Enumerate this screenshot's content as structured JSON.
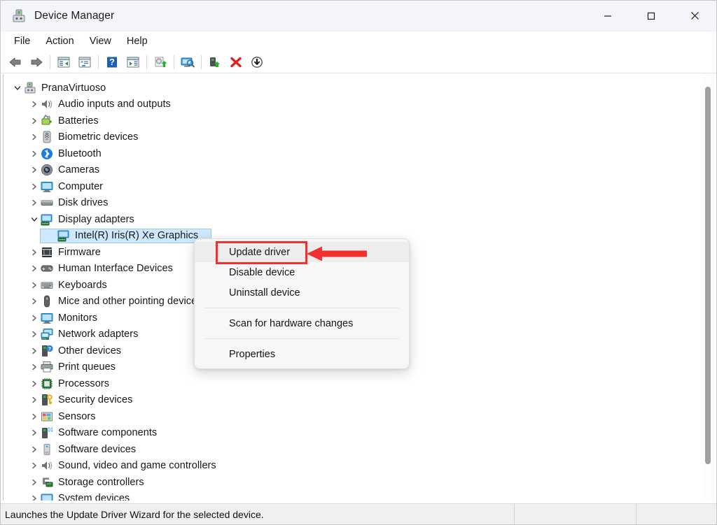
{
  "window": {
    "title": "Device Manager",
    "icon": "device-manager-icon",
    "controls": {
      "minimize": "—",
      "maximize": "□",
      "close": "✕"
    }
  },
  "menubar": {
    "items": [
      {
        "label": "File"
      },
      {
        "label": "Action"
      },
      {
        "label": "View"
      },
      {
        "label": "Help"
      }
    ]
  },
  "toolbar": {
    "buttons": [
      {
        "name": "back-icon"
      },
      {
        "name": "forward-icon"
      },
      {
        "name": "show-hide-console-tree-icon"
      },
      {
        "name": "properties-icon"
      },
      {
        "name": "help-icon"
      },
      {
        "name": "view-icon"
      },
      {
        "name": "update-driver-icon"
      },
      {
        "name": "scan-hardware-changes-icon"
      },
      {
        "name": "enable-device-icon"
      },
      {
        "name": "uninstall-device-icon"
      },
      {
        "name": "disable-device-icon"
      }
    ]
  },
  "tree": {
    "root": {
      "label": "PranaVirtuoso",
      "icon": "computer-node-icon",
      "expanded": true,
      "depth": 0
    },
    "nodes": [
      {
        "label": "Audio inputs and outputs",
        "icon": "speaker-icon",
        "expanded": false,
        "depth": 1
      },
      {
        "label": "Batteries",
        "icon": "battery-icon",
        "expanded": false,
        "depth": 1
      },
      {
        "label": "Biometric devices",
        "icon": "fingerprint-icon",
        "expanded": false,
        "depth": 1
      },
      {
        "label": "Bluetooth",
        "icon": "bluetooth-icon",
        "expanded": false,
        "depth": 1
      },
      {
        "label": "Cameras",
        "icon": "camera-icon",
        "expanded": false,
        "depth": 1
      },
      {
        "label": "Computer",
        "icon": "monitor-icon",
        "expanded": false,
        "depth": 1
      },
      {
        "label": "Disk drives",
        "icon": "disk-drive-icon",
        "expanded": false,
        "depth": 1
      },
      {
        "label": "Display adapters",
        "icon": "display-adapter-icon",
        "expanded": true,
        "depth": 1
      },
      {
        "label": "Intel(R) Iris(R) Xe Graphics",
        "icon": "display-adapter-icon",
        "expanded": null,
        "depth": 2,
        "selected": true
      },
      {
        "label": "Firmware",
        "icon": "firmware-icon",
        "expanded": false,
        "depth": 1
      },
      {
        "label": "Human Interface Devices",
        "icon": "hid-icon",
        "expanded": false,
        "depth": 1
      },
      {
        "label": "Keyboards",
        "icon": "keyboard-icon",
        "expanded": false,
        "depth": 1
      },
      {
        "label": "Mice and other pointing devices",
        "icon": "mouse-icon",
        "expanded": false,
        "depth": 1
      },
      {
        "label": "Monitors",
        "icon": "monitor-icon",
        "expanded": false,
        "depth": 1
      },
      {
        "label": "Network adapters",
        "icon": "network-adapter-icon",
        "expanded": false,
        "depth": 1
      },
      {
        "label": "Other devices",
        "icon": "unknown-device-icon",
        "expanded": false,
        "depth": 1
      },
      {
        "label": "Print queues",
        "icon": "printer-icon",
        "expanded": false,
        "depth": 1
      },
      {
        "label": "Processors",
        "icon": "processor-icon",
        "expanded": false,
        "depth": 1
      },
      {
        "label": "Security devices",
        "icon": "security-device-icon",
        "expanded": false,
        "depth": 1
      },
      {
        "label": "Sensors",
        "icon": "sensor-icon",
        "expanded": false,
        "depth": 1
      },
      {
        "label": "Software components",
        "icon": "software-component-icon",
        "expanded": false,
        "depth": 1
      },
      {
        "label": "Software devices",
        "icon": "software-device-icon",
        "expanded": false,
        "depth": 1
      },
      {
        "label": "Sound, video and game controllers",
        "icon": "speaker-icon",
        "expanded": false,
        "depth": 1
      },
      {
        "label": "Storage controllers",
        "icon": "storage-controller-icon",
        "expanded": false,
        "depth": 1
      },
      {
        "label": "System devices",
        "icon": "system-device-icon",
        "expanded": false,
        "depth": 1
      }
    ]
  },
  "context_menu": {
    "items": [
      {
        "label": "Update driver",
        "highlighted": true
      },
      {
        "label": "Disable device"
      },
      {
        "label": "Uninstall device"
      },
      {
        "separator": true
      },
      {
        "label": "Scan for hardware changes"
      },
      {
        "separator": true
      },
      {
        "label": "Properties"
      }
    ]
  },
  "annotation": {
    "color": "#f23030",
    "highlight_target": "Update driver",
    "arrow_direction": "left"
  },
  "statusbar": {
    "message": "Launches the Update Driver Wizard for the selected device.",
    "pane2": "",
    "pane3": ""
  },
  "colors": {
    "titlebar": "#f3f5f8",
    "selection": "#cde8ff",
    "selection_border": "#99c9ef",
    "menu_bg": "#f7f7f7",
    "annotation_red": "#f23030",
    "scrollbar_thumb": "#a0a0a0"
  }
}
